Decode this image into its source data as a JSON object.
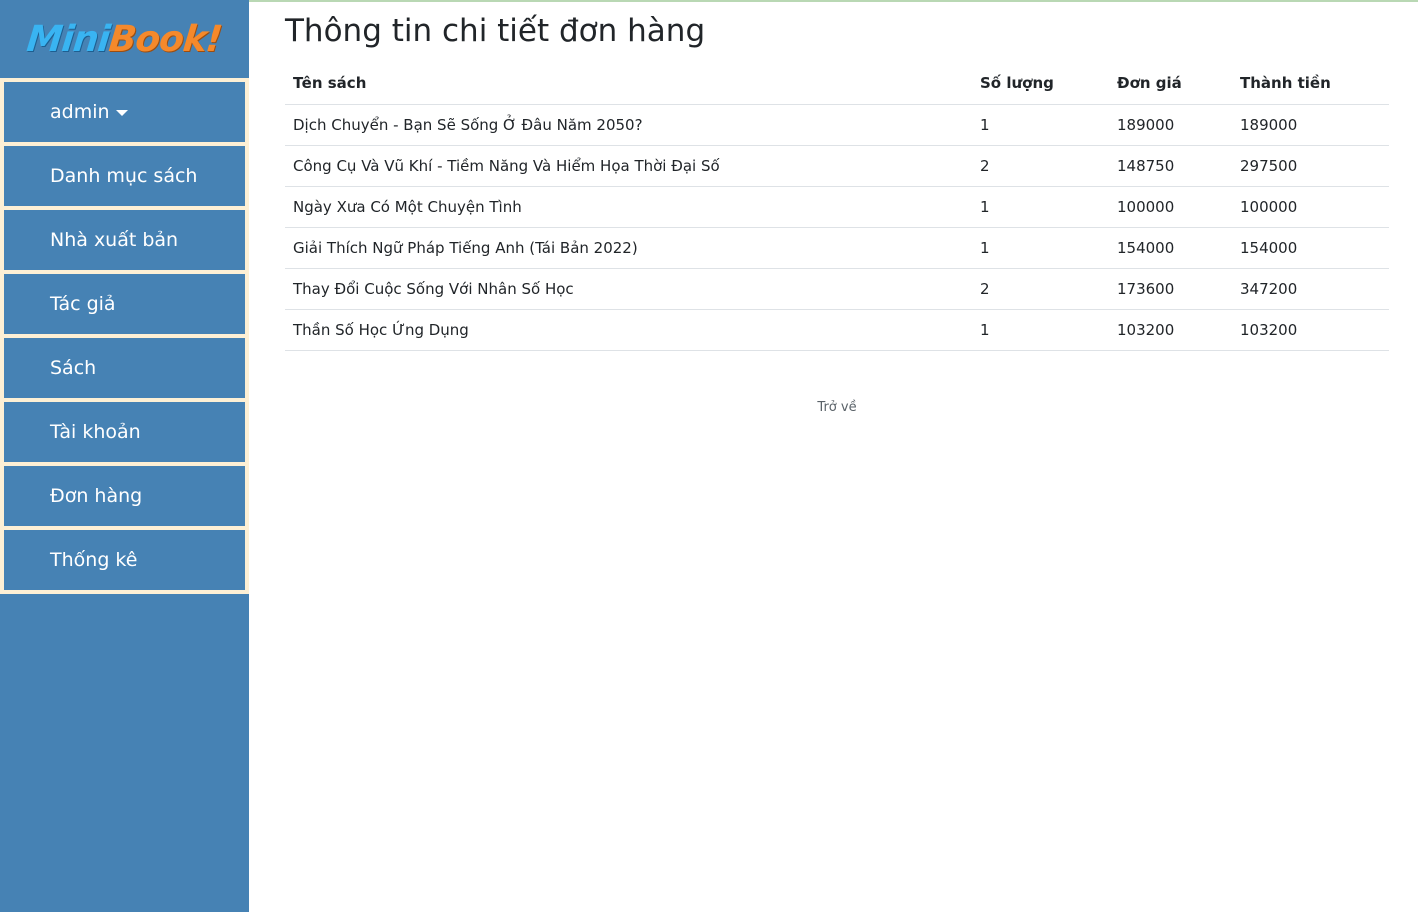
{
  "logo": {
    "part1": "Mini",
    "part2": "Book!"
  },
  "sidebar": {
    "items": [
      {
        "label": "admin",
        "has_caret": true
      },
      {
        "label": "Danh mục sách"
      },
      {
        "label": "Nhà xuất bản"
      },
      {
        "label": "Tác giả"
      },
      {
        "label": "Sách"
      },
      {
        "label": "Tài khoản"
      },
      {
        "label": "Đơn hàng"
      },
      {
        "label": "Thống kê"
      }
    ]
  },
  "main": {
    "title": "Thông tin chi tiết đơn hàng",
    "table": {
      "headers": [
        "Tên sách",
        "Số lượng",
        "Đơn giá",
        "Thành tiền"
      ],
      "rows": [
        [
          "Dịch Chuyển - Bạn Sẽ Sống Ở Đâu Năm 2050?",
          "1",
          "189000",
          "189000"
        ],
        [
          "Công Cụ Và Vũ Khí - Tiềm Năng Và Hiểm Họa Thời Đại Số",
          "2",
          "148750",
          "297500"
        ],
        [
          "Ngày Xưa Có Một Chuyện Tình",
          "1",
          "100000",
          "100000"
        ],
        [
          "Giải Thích Ngữ Pháp Tiếng Anh (Tái Bản 2022)",
          "1",
          "154000",
          "154000"
        ],
        [
          "Thay Đổi Cuộc Sống Với Nhân Số Học",
          "2",
          "173600",
          "347200"
        ],
        [
          "Thần Số Học Ứng Dụng",
          "1",
          "103200",
          "103200"
        ]
      ]
    },
    "back_label": "Trở về"
  },
  "colors": {
    "sidebar_bg": "#4682b4",
    "sidebar_border": "#fdf0d5",
    "logo_blue": "#39b4f2",
    "logo_orange": "#f5892b"
  }
}
